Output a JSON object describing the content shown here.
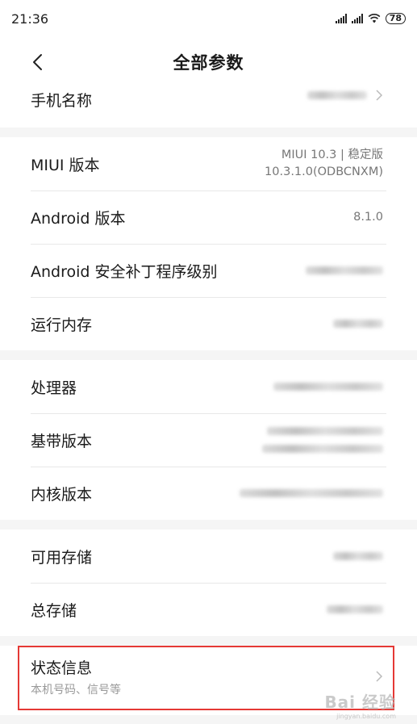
{
  "status_bar": {
    "time": "21:36",
    "battery": "78",
    "icons": [
      "signal-icon",
      "signal-icon",
      "wifi-icon",
      "battery-icon"
    ]
  },
  "header": {
    "title": "全部参数",
    "back_icon": "chevron-left-icon"
  },
  "sections": {
    "device": {
      "phone_name_label": "手机名称"
    },
    "software": {
      "miui_label": "MIUI 版本",
      "miui_value_line1": "MIUI 10.3 | 稳定版",
      "miui_value_line2": "10.3.1.0(ODBCNXM)",
      "android_label": "Android 版本",
      "android_value": "8.1.0",
      "security_patch_label": "Android 安全补丁程序级别",
      "ram_label": "运行内存"
    },
    "hardware": {
      "processor_label": "处理器",
      "baseband_label": "基带版本",
      "kernel_label": "内核版本"
    },
    "storage": {
      "available_label": "可用存储",
      "total_label": "总存储"
    },
    "status": {
      "label": "状态信息",
      "sub": "本机号码、信号等"
    }
  },
  "watermark": {
    "brand": "Bai 经验",
    "url": "jingyan.baidu.com"
  },
  "colors": {
    "highlight_border": "#e53935",
    "section_gap": "#f5f5f5",
    "secondary_text": "#777777"
  }
}
